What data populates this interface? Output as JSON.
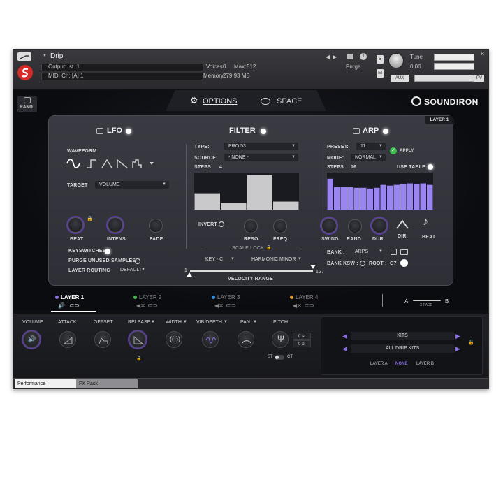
{
  "header": {
    "instrument_name": "Drip",
    "output_label": "Output:",
    "output_value": "st. 1",
    "midi_label": "MIDI Ch:",
    "midi_value": "[A] 1",
    "voices_label": "Voices:",
    "voices_value": "0",
    "max_label": "Max:",
    "max_value": "512",
    "purge_label": "Purge",
    "memory_label": "Memory:",
    "memory_value": "279.93 MB",
    "tune_label": "Tune",
    "tune_value": "0.00",
    "s_button": "S",
    "m_button": "M",
    "aux_label": "AUX",
    "pv_label": "PV"
  },
  "top_nav": {
    "rand_label": "RAND",
    "options_label": "OPTIONS",
    "space_label": "SPACE",
    "brand": "SOUNDIRON",
    "layer_badge": "LAYER 1"
  },
  "lfo": {
    "title": "LFO",
    "waveform_label": "WAVEFORM",
    "target_label": "TARGET",
    "target_value": "VOLUME",
    "beat_label": "BEAT",
    "intens_label": "INTENS.",
    "fade_label": "FADE",
    "keyswitches_label": "KEYSWITCHES",
    "purge_label": "PURGE UNUSED SAMPLES",
    "routing_label": "LAYER ROUTING",
    "routing_value": "DEFAULT"
  },
  "filter": {
    "title": "FILTER",
    "type_label": "TYPE:",
    "type_value": "PRO 53",
    "source_label": "SOURCE:",
    "source_value": "- NONE -",
    "steps_label": "STEPS",
    "steps_value": "4",
    "step_levels": [
      0.45,
      0.18,
      0.95,
      0.22
    ],
    "invert_label": "INVERT",
    "reso_label": "RESO.",
    "freq_label": "FREQ.",
    "scale_lock_label": "SCALE LOCK",
    "key_value": "KEY - C",
    "scale_value": "HARMONIC MINOR",
    "velocity_label": "VELOCITY RANGE",
    "velocity_min": "1",
    "velocity_max": "127"
  },
  "arp": {
    "title": "ARP",
    "preset_label": "PRESET:",
    "preset_value": "11",
    "apply_label": "APPLY",
    "mode_label": "MODE:",
    "mode_value": "NORMAL",
    "steps_label": "STEPS",
    "steps_value": "16",
    "use_table_label": "USE TABLE",
    "step_levels": [
      0.85,
      0.62,
      0.62,
      0.62,
      0.6,
      0.6,
      0.58,
      0.6,
      0.68,
      0.66,
      0.68,
      0.7,
      0.72,
      0.7,
      0.72,
      0.68
    ],
    "swing_label": "SWING",
    "rand_label": "RAND.",
    "dur_label": "DUR.",
    "dir_label": "DIR.",
    "beat_label": "BEAT",
    "bank_label": "BANK :",
    "bank_value": "ARPS",
    "bank_ksw_label": "BANK KSW :",
    "root_label": "ROOT :",
    "root_value": "G7"
  },
  "layers": [
    {
      "label": "LAYER 1",
      "color": "#8a6fe0"
    },
    {
      "label": "LAYER 2",
      "color": "#4fb35a"
    },
    {
      "label": "LAYER 3",
      "color": "#3b8fd8"
    },
    {
      "label": "LAYER 4",
      "color": "#e0a030"
    }
  ],
  "xfade": {
    "a_label": "A",
    "b_label": "B",
    "label": "X-FADE"
  },
  "bottom": {
    "volume_label": "VOLUME",
    "attack_label": "ATTACK",
    "offset_label": "OFFSET",
    "release_label": "RELEASE",
    "width_label": "WIDTH",
    "vibdepth_label": "VIB.DEPTH",
    "pan_label": "PAN",
    "pitch_label": "PITCH",
    "pitch_st": "0 st",
    "pitch_ct": "0 ct",
    "st_label": "ST",
    "ct_label": "CT",
    "kits_label": "KITS",
    "all_kits_label": "ALL DRIP KITS",
    "layer_a_label": "LAYER A",
    "none_label": "NONE",
    "layer_b_label": "LAYER B"
  },
  "footer_tabs": {
    "performance": "Performance",
    "fx_rack": "FX Rack"
  },
  "colors": {
    "accent": "#8a6fe0",
    "arp_bars": "#9b85f0",
    "apply_green": "#3fbf4f"
  }
}
